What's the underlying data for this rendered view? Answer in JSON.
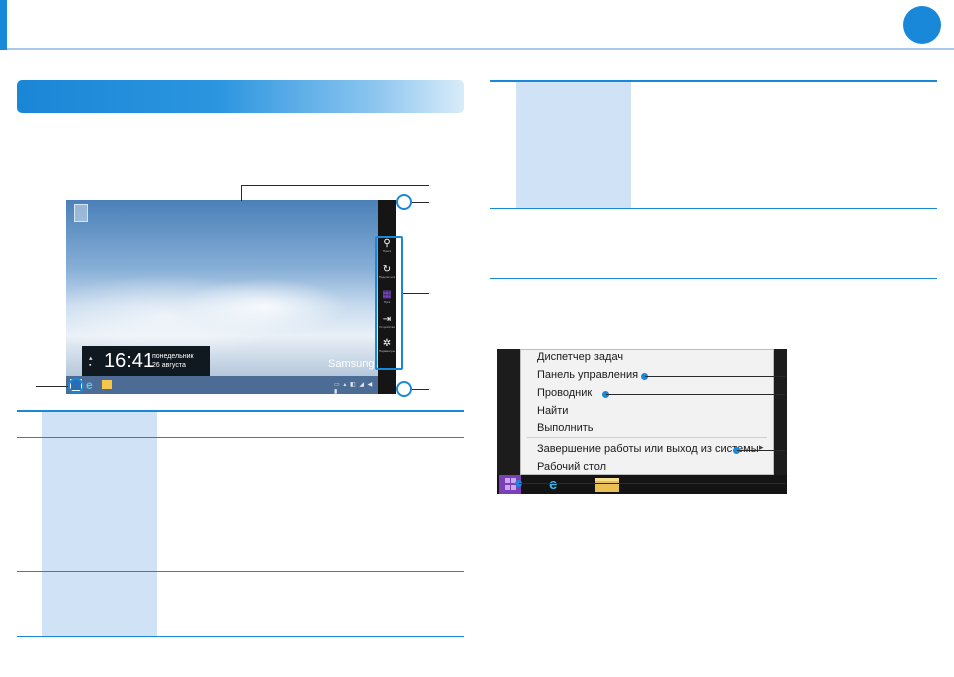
{
  "colors": {
    "accent": "#1a88d8",
    "cell": "#cfe2f6"
  },
  "desktop": {
    "time": "16:41",
    "day": "понедельник",
    "date": "26 августа",
    "brand": "Samsung ATI",
    "charms": [
      {
        "icon": "search-icon",
        "label": "Поиск"
      },
      {
        "icon": "share-icon",
        "label": "Поделиться"
      },
      {
        "icon": "start-icon",
        "label": "Пуск"
      },
      {
        "icon": "devices-icon",
        "label": "Устройства"
      },
      {
        "icon": "gear-icon",
        "label": "Параметры"
      }
    ]
  },
  "menu": {
    "items": [
      "Диспетчер задач",
      "Панель управления",
      "Проводник",
      "Найти",
      "Выполнить",
      "Завершение работы или выход из системы",
      "Рабочий стол"
    ]
  }
}
